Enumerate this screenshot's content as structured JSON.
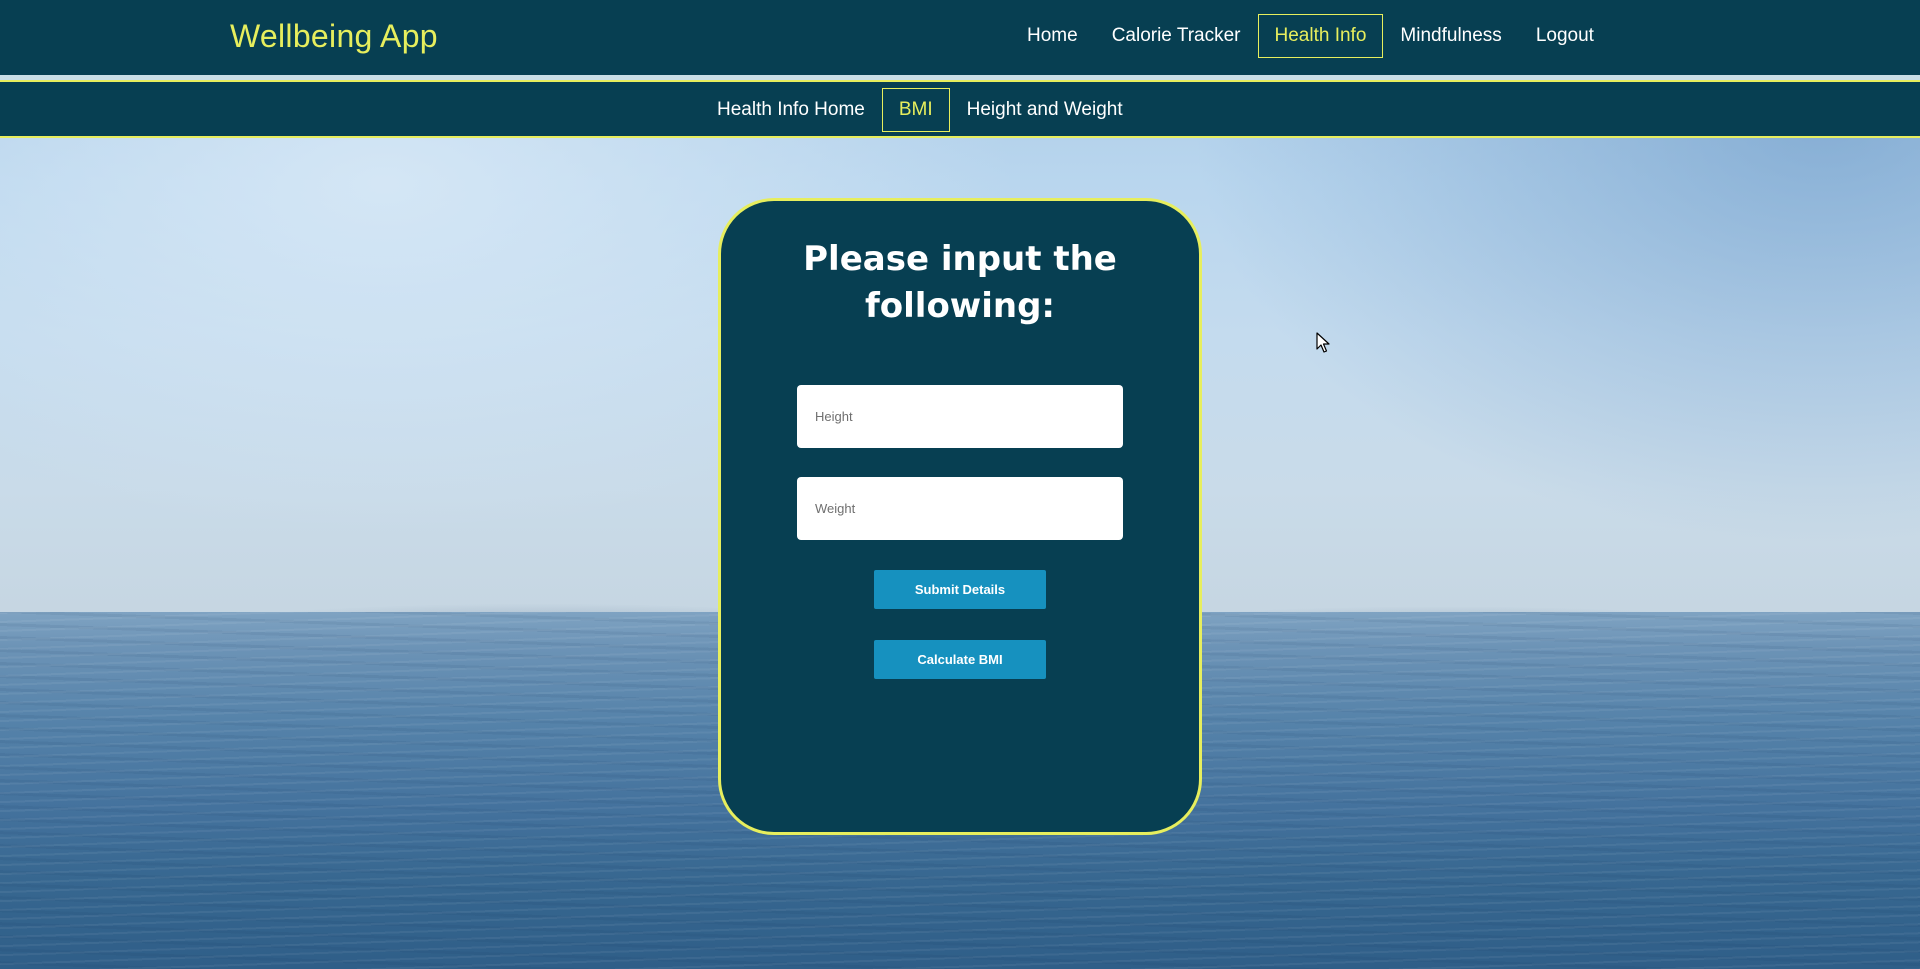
{
  "app": {
    "title": "Wellbeing App"
  },
  "main_nav": {
    "items": [
      {
        "label": "Home",
        "active": false
      },
      {
        "label": "Calorie Tracker",
        "active": false
      },
      {
        "label": "Health Info",
        "active": true
      },
      {
        "label": "Mindfulness",
        "active": false
      },
      {
        "label": "Logout",
        "active": false
      }
    ]
  },
  "sub_nav": {
    "items": [
      {
        "label": "Health Info Home",
        "active": false
      },
      {
        "label": "BMI",
        "active": true
      },
      {
        "label": "Height and Weight",
        "active": false
      }
    ]
  },
  "form": {
    "title": "Please input the following:",
    "height": {
      "placeholder": "Height",
      "value": ""
    },
    "weight": {
      "placeholder": "Weight",
      "value": ""
    },
    "submit_label": "Submit Details",
    "calculate_label": "Calculate BMI"
  },
  "colors": {
    "nav_background": "#073f52",
    "accent": "#e7ee5d",
    "button": "#1691bf",
    "text": "#ffffff"
  },
  "icons": {
    "cursor": "mouse-pointer-icon"
  }
}
